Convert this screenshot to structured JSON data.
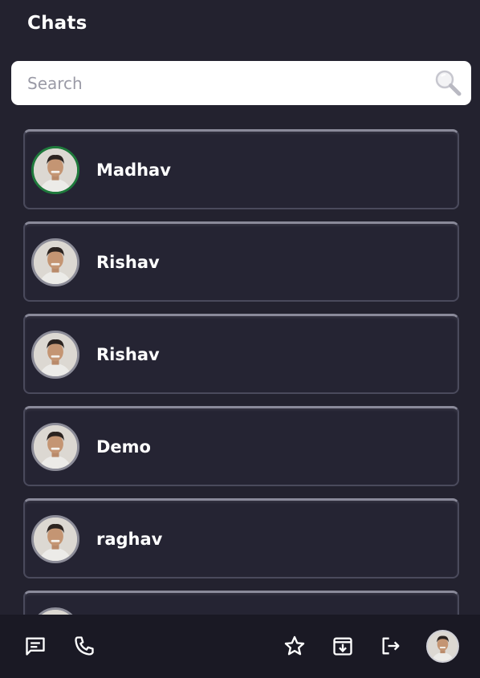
{
  "header": {
    "title": "Chats"
  },
  "search": {
    "placeholder": "Search",
    "value": ""
  },
  "chats": [
    {
      "name": "Madhav",
      "online": true
    },
    {
      "name": "Rishav",
      "online": false
    },
    {
      "name": "Rishav",
      "online": false
    },
    {
      "name": "Demo",
      "online": false
    },
    {
      "name": "raghav",
      "online": false
    },
    {
      "name": "",
      "online": false
    }
  ],
  "bottom_nav": {
    "icons": [
      "chat-icon",
      "phone-icon",
      "star-icon",
      "archive-icon",
      "logout-icon",
      "profile-avatar"
    ]
  },
  "colors": {
    "background": "#23222f",
    "bottom_bar": "#1a1924",
    "online_ring": "#1f7a3c",
    "text": "#ffffff"
  }
}
